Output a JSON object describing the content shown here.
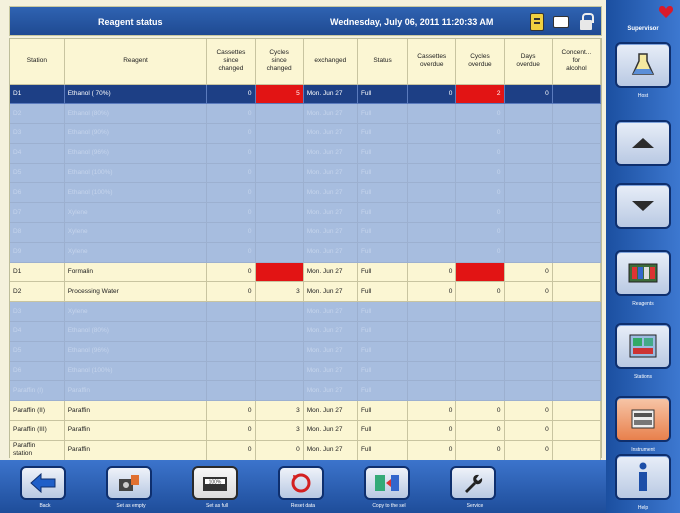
{
  "header": {
    "title": "Reagent status",
    "datetime": "Wednesday, July 06, 2011 11:20:33 AM"
  },
  "table": {
    "columns": [
      "Station",
      "Reagent",
      "Cassettes\nsince\nchanged",
      "Cycles\nsince\nchanged",
      "exchanged",
      "Status",
      "Cassettes\noverdue",
      "Cycles\noverdue",
      "Days\noverdue",
      "Concent...\nfor\nalcohol"
    ],
    "rows": [
      {
        "kind": "sel",
        "cells": [
          "D1",
          "Ethanol ( 70%)",
          "0",
          "5",
          "Mon. Jun 27",
          "Full",
          "0",
          "2",
          "0",
          ""
        ],
        "red": [
          3,
          7
        ]
      },
      {
        "kind": "blank",
        "cells": [
          "D2",
          "Ethanol (80%)",
          "0",
          "",
          "Mon. Jun 27",
          "Full",
          "",
          "0",
          "",
          ""
        ],
        "red": []
      },
      {
        "kind": "blank",
        "cells": [
          "D3",
          "Ethanol (90%)",
          "0",
          "",
          "Mon. Jun 27",
          "Full",
          "",
          "0",
          "",
          ""
        ],
        "red": []
      },
      {
        "kind": "blank",
        "cells": [
          "D4",
          "Ethanol (96%)",
          "0",
          "",
          "Mon. Jun 27",
          "Full",
          "",
          "0",
          "",
          ""
        ],
        "red": []
      },
      {
        "kind": "blank",
        "cells": [
          "D5",
          "Ethanol (100%)",
          "0",
          "",
          "Mon. Jun 27",
          "Full",
          "",
          "0",
          "",
          ""
        ],
        "red": []
      },
      {
        "kind": "blank",
        "cells": [
          "D6",
          "Ethanol (100%)",
          "0",
          "",
          "Mon. Jun 27",
          "Full",
          "",
          "0",
          "",
          ""
        ],
        "red": []
      },
      {
        "kind": "blank",
        "cells": [
          "D7",
          "Xylene",
          "0",
          "",
          "Mon. Jun 27",
          "Full",
          "",
          "0",
          "",
          ""
        ],
        "red": []
      },
      {
        "kind": "blank",
        "cells": [
          "D8",
          "Xylene",
          "0",
          "",
          "Mon. Jun 27",
          "Full",
          "",
          "0",
          "",
          ""
        ],
        "red": []
      },
      {
        "kind": "blank",
        "cells": [
          "D9",
          "Xylene",
          "0",
          "",
          "Mon. Jun 27",
          "Full",
          "",
          "0",
          "",
          ""
        ],
        "red": []
      },
      {
        "kind": "full",
        "cells": [
          "D1",
          "Formalin",
          "0",
          "",
          "Mon. Jun 27",
          "Full",
          "0",
          "",
          "0",
          ""
        ],
        "red": [
          3,
          7
        ]
      },
      {
        "kind": "full",
        "cells": [
          "D2",
          "Processing Water",
          "0",
          "3",
          "Mon. Jun 27",
          "Full",
          "0",
          "0",
          "0",
          ""
        ],
        "red": []
      },
      {
        "kind": "blank",
        "cells": [
          "D3",
          "Xylene",
          "",
          "",
          "Mon. Jun 27",
          "Full",
          "",
          "",
          "",
          ""
        ],
        "red": []
      },
      {
        "kind": "blank",
        "cells": [
          "D4",
          "Ethanol (80%)",
          "",
          "",
          "Mon. Jun 27",
          "Full",
          "",
          "",
          "",
          ""
        ],
        "red": []
      },
      {
        "kind": "blank",
        "cells": [
          "D5",
          "Ethanol (96%)",
          "",
          "",
          "Mon. Jun 27",
          "Full",
          "",
          "",
          "",
          ""
        ],
        "red": []
      },
      {
        "kind": "blank",
        "cells": [
          "D6",
          "Ethanol (100%)",
          "",
          "",
          "Mon. Jun 27",
          "Full",
          "",
          "",
          "",
          ""
        ],
        "red": []
      },
      {
        "kind": "blank",
        "cells": [
          "Paraffin (I)",
          "Paraffin",
          "",
          "",
          "Mon. Jun 27",
          "Full",
          "",
          "",
          "",
          ""
        ],
        "red": []
      },
      {
        "kind": "full",
        "cells": [
          "Paraffin (II)",
          "Paraffin",
          "0",
          "3",
          "Mon. Jun 27",
          "Full",
          "0",
          "0",
          "0",
          ""
        ],
        "red": []
      },
      {
        "kind": "full",
        "cells": [
          "Paraffin (III)",
          "Paraffin",
          "0",
          "3",
          "Mon. Jun 27",
          "Full",
          "0",
          "0",
          "0",
          ""
        ],
        "red": []
      },
      {
        "kind": "full",
        "cells": [
          "Paraffin\nstation",
          "Paraffin",
          "0",
          "0",
          "Mon. Jun 27",
          "Full",
          "0",
          "0",
          "0",
          ""
        ],
        "red": []
      }
    ]
  },
  "sidebar": {
    "supervisor": "Supervisor",
    "buttons": [
      {
        "label": "Host",
        "icon": "flask-icon"
      },
      {
        "label": "",
        "icon": "arrow-up-icon"
      },
      {
        "label": "",
        "icon": "arrow-down-icon"
      },
      {
        "label": "Reagents",
        "icon": "reagents-icon"
      },
      {
        "label": "Stations",
        "icon": "stations-icon"
      },
      {
        "label": "Instrument",
        "icon": "instrument-icon"
      },
      {
        "label": "Help",
        "icon": "info-icon"
      }
    ]
  },
  "toolbar": {
    "buttons": [
      {
        "label": "Back",
        "icon": "back-arrow-icon"
      },
      {
        "label": "Set as empty",
        "icon": "empty-icon"
      },
      {
        "label": "Set as full",
        "icon": "full-icon"
      },
      {
        "label": "Reset data",
        "icon": "reset-icon"
      },
      {
        "label": "Copy to the sel",
        "icon": "copy-icon"
      },
      {
        "label": "Service",
        "icon": "wrench-icon"
      }
    ]
  },
  "colors": {
    "header_blue": "#1f4a92",
    "selected_row": "#1d3f85",
    "blank_row": "#a7bddf",
    "cream": "#fbf6d3",
    "alert_red": "#e21414",
    "orange_button": "#e8804c"
  }
}
